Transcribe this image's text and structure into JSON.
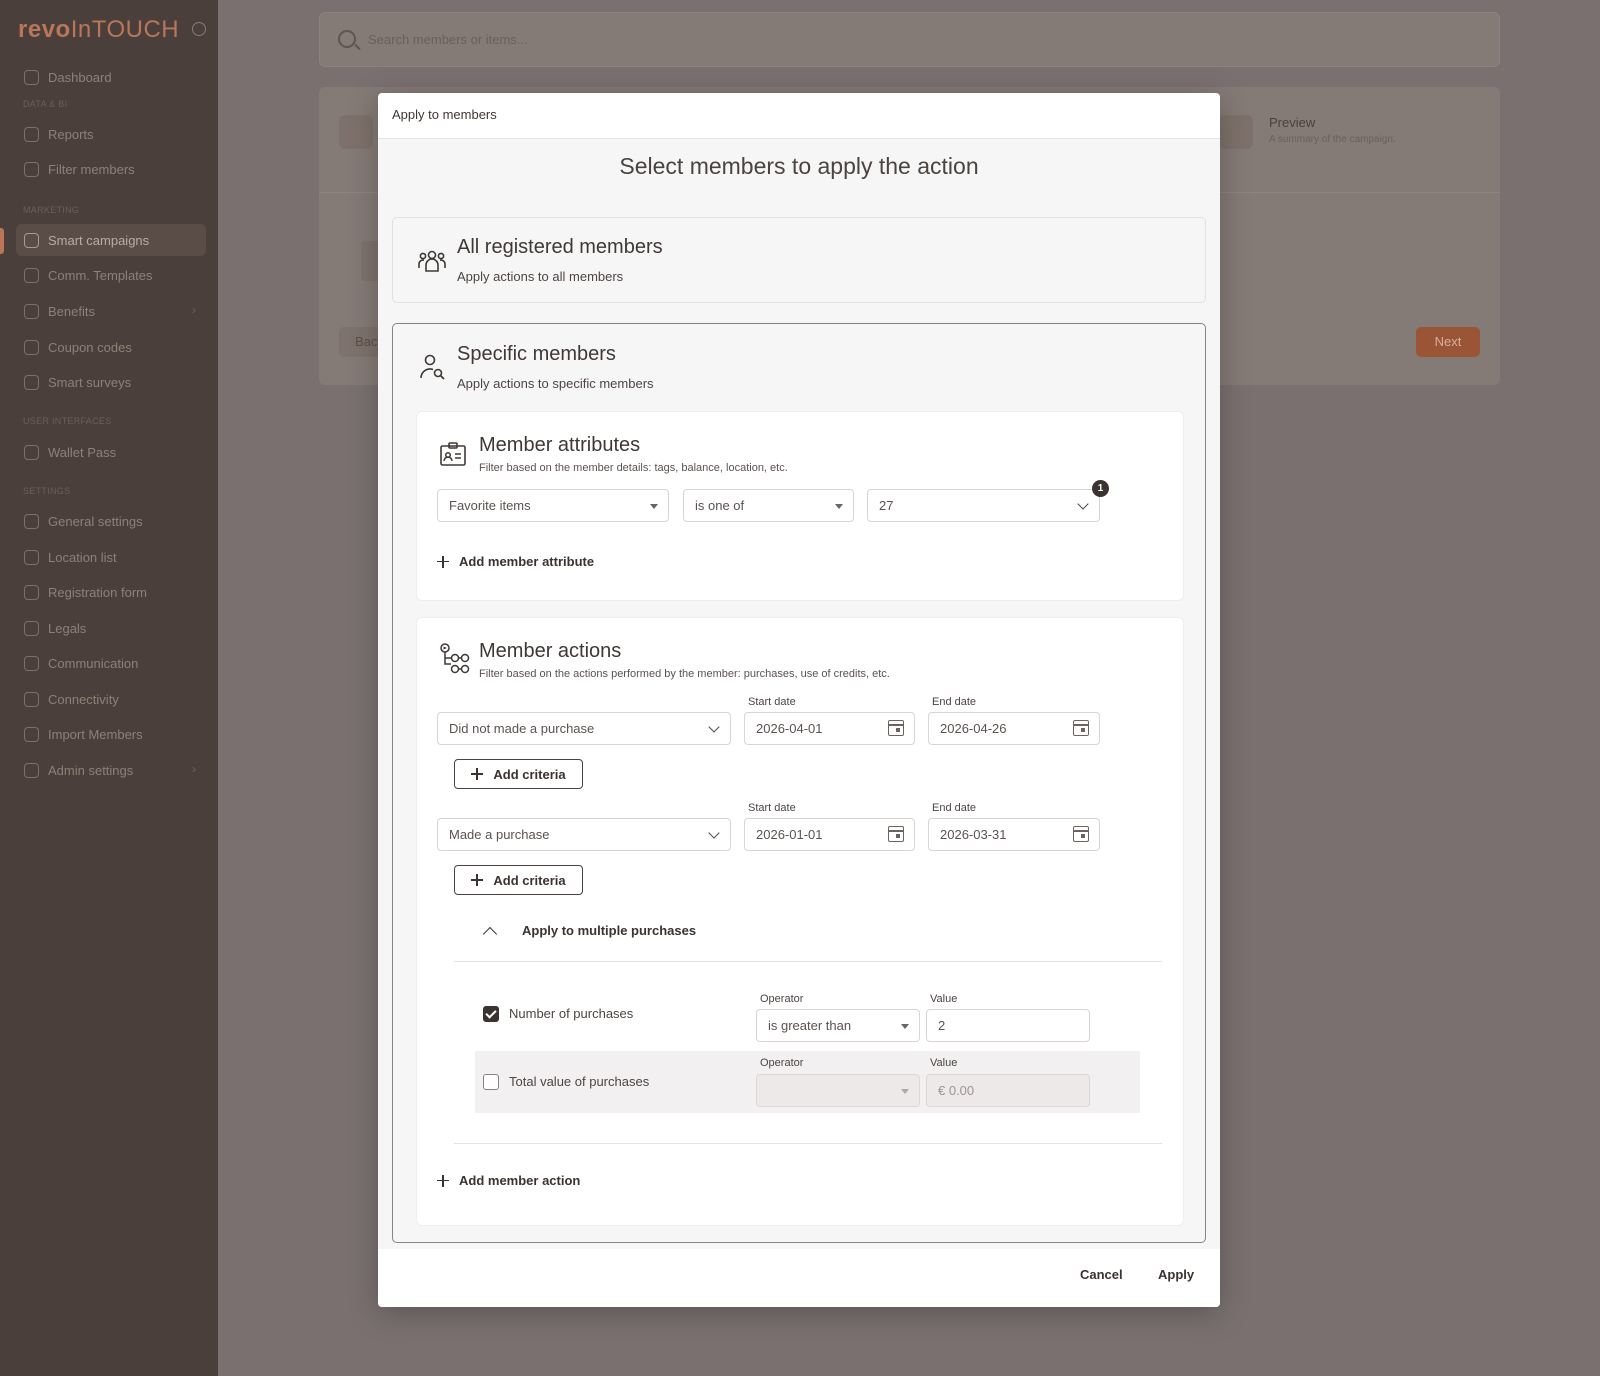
{
  "sidebar": {
    "logo_a": "revo",
    "logo_b": "InTOUCH",
    "items": [
      {
        "label": "Dashboard"
      },
      {
        "label": "Reports"
      },
      {
        "label": "Filter members"
      },
      {
        "label": "Smart campaigns"
      },
      {
        "label": "Comm. Templates"
      },
      {
        "label": "Benefits"
      },
      {
        "label": "Coupon codes"
      },
      {
        "label": "Smart surveys"
      },
      {
        "label": "Wallet Pass"
      },
      {
        "label": "General settings"
      },
      {
        "label": "Location list"
      },
      {
        "label": "Registration form"
      },
      {
        "label": "Legals"
      },
      {
        "label": "Communication"
      },
      {
        "label": "Connectivity"
      },
      {
        "label": "Import Members"
      },
      {
        "label": "Admin settings"
      }
    ],
    "sections": {
      "data": "DATA & BI",
      "marketing": "MARKETING",
      "ui": "USER INTERFACES",
      "settings": "SETTINGS"
    }
  },
  "background": {
    "search_placeholder": "Search members or items...",
    "preview_title": "Preview",
    "preview_sub": "A summary of the campaign.",
    "back_label": "Back",
    "next_label": "Next"
  },
  "modal": {
    "header": "Apply to members",
    "heading": "Select members to apply the action",
    "all": {
      "title": "All registered members",
      "subtitle": "Apply actions to all members"
    },
    "specific": {
      "title": "Specific members",
      "subtitle": "Apply actions to specific members"
    },
    "attributes": {
      "title": "Member attributes",
      "subtitle": "Filter based on the member details: tags, balance, location, etc.",
      "field": "Favorite items",
      "operator": "is one of",
      "value": "27",
      "count_badge": "1",
      "add_label": "Add member attribute"
    },
    "actions": {
      "title": "Member actions",
      "subtitle": "Filter based on the actions performed by the member: purchases, use of credits, etc.",
      "start_label": "Start date",
      "end_label": "End date",
      "rows": [
        {
          "action": "Did not made a purchase",
          "start": "2026-04-01",
          "end": "2026-04-26"
        },
        {
          "action": "Made a purchase",
          "start": "2026-01-01",
          "end": "2026-03-31"
        }
      ],
      "add_criteria_label": "Add criteria",
      "multiple_label": "Apply to multiple purchases",
      "operator_label": "Operator",
      "value_label": "Value",
      "number_of_purchases": {
        "label": "Number of purchases",
        "checked": true,
        "operator": "is greater than",
        "value": "2"
      },
      "total_value": {
        "label": "Total value of purchases",
        "checked": false,
        "operator": "",
        "placeholder": "€ 0.00"
      },
      "add_label": "Add member action"
    },
    "cancel_label": "Cancel",
    "apply_label": "Apply"
  }
}
